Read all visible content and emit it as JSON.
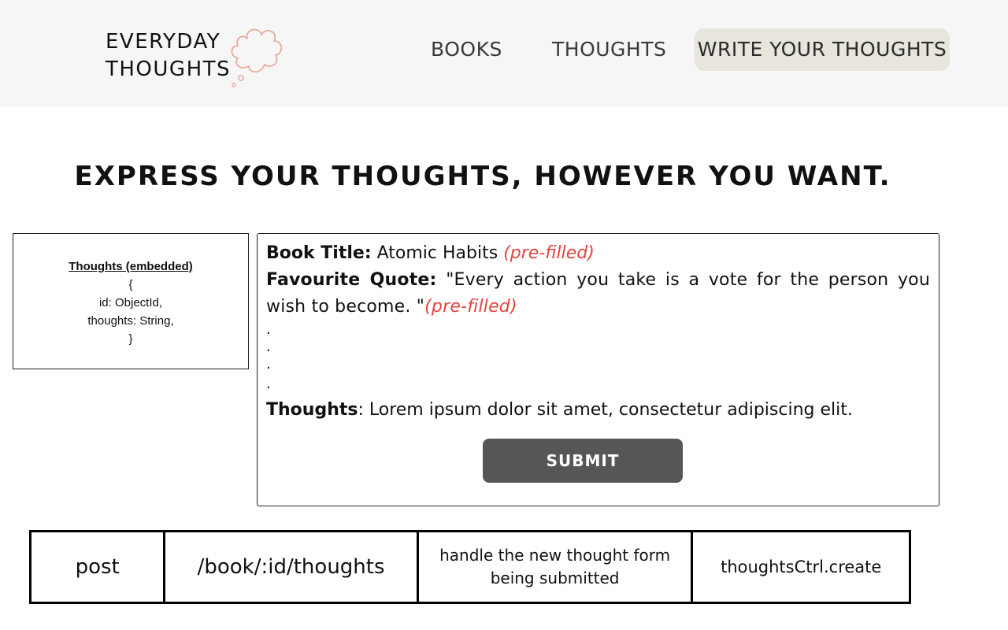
{
  "header": {
    "logo": {
      "line1": "EVERYDAY",
      "line2": "THOUGHTS",
      "icon": "thought-cloud-icon"
    },
    "nav": {
      "books": "BOOKS",
      "thoughts": "THOUGHTS",
      "write": "WRITE YOUR THOUGHTS"
    },
    "active_color": "#e7e5dc"
  },
  "main": {
    "headline": "EXPRESS YOUR THOUGHTS, HOWEVER YOU WANT."
  },
  "schema": {
    "title": "Thoughts (embedded)",
    "lines": [
      "{",
      "id: ObjectId,",
      "thoughts: String,",
      "}"
    ]
  },
  "form": {
    "book_title_label": "Book Title:",
    "book_title_value": "Atomic Habits",
    "book_title_note": "(pre-filled)",
    "quote_label": "Favourite Quote:",
    "quote_value": "\"Every action you take is a vote for the person you wish to become. \"",
    "quote_note": "(pre-filled)",
    "dots": [
      ".",
      ".",
      ".",
      "."
    ],
    "thoughts_label": "Thoughts",
    "thoughts_value": ": Lorem ipsum dolor sit amet, consectetur adipiscing elit.",
    "submit_label": "SUBMIT",
    "note_color": "#e5433e",
    "submit_color": "#565656"
  },
  "route": {
    "method": "post",
    "path": "/book/:id/thoughts",
    "description": "handle the new thought form being submitted",
    "handler": "thoughtsCtrl.create"
  }
}
